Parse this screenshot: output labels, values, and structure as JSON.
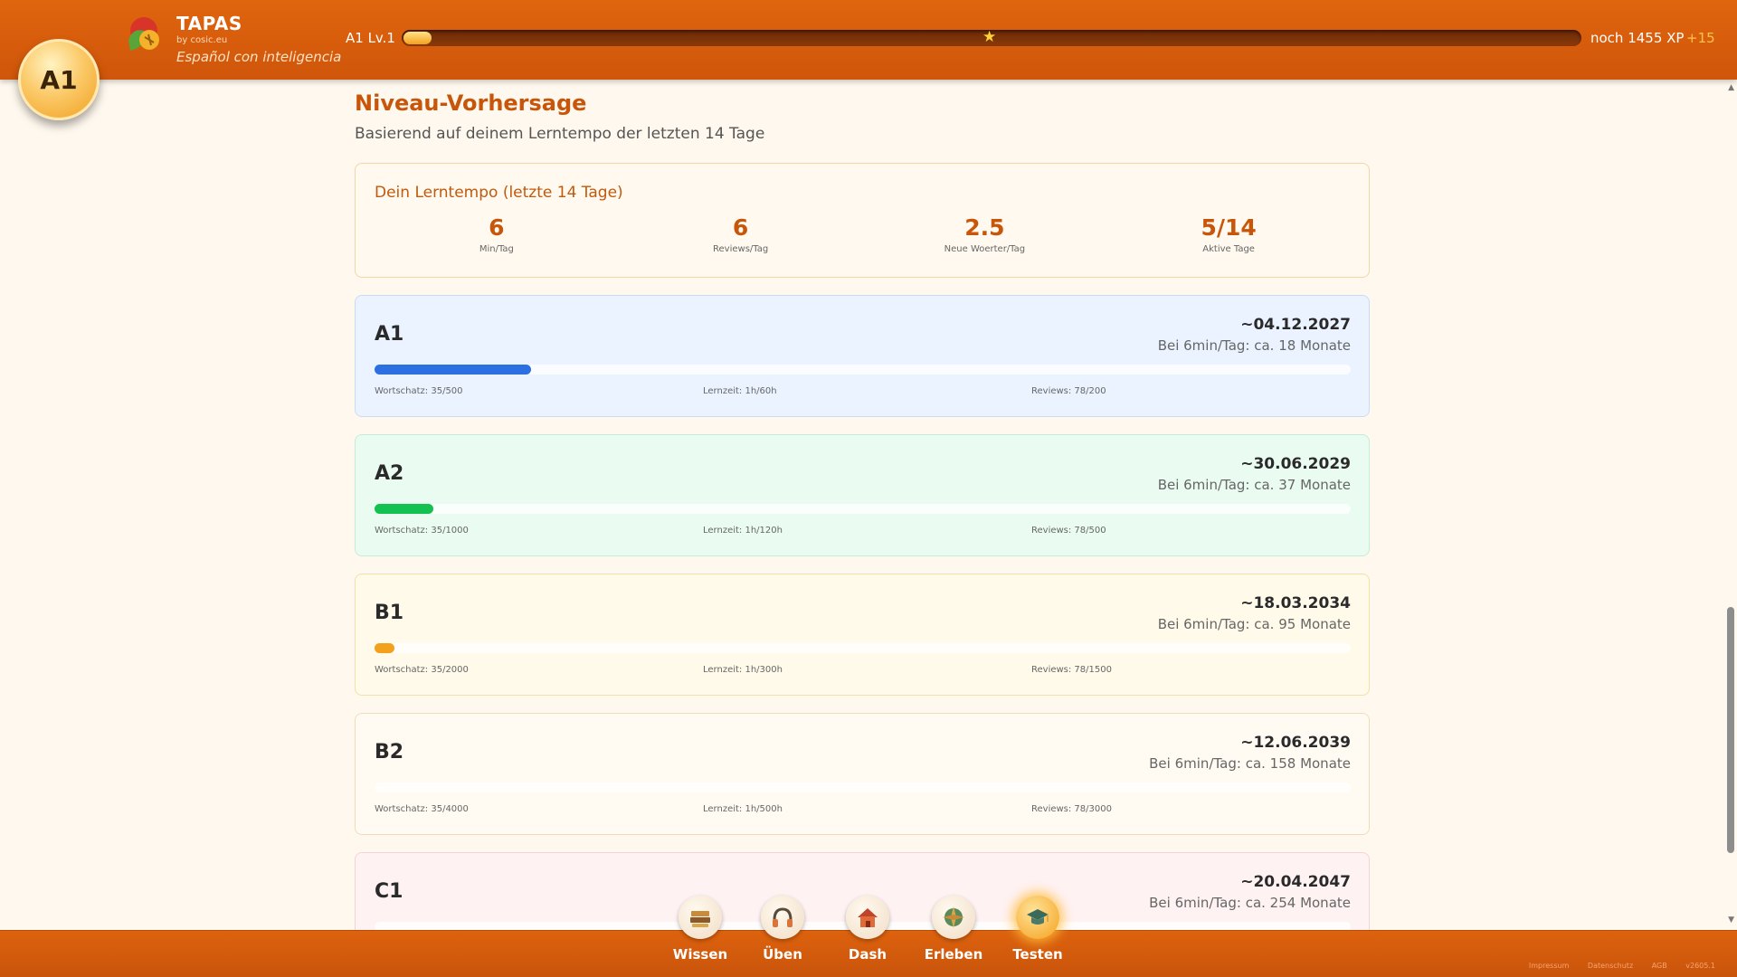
{
  "header": {
    "level_badge": "A1",
    "brand_name": "TAPAS",
    "brand_by": "by cosic.eu",
    "brand_tagline": "Español con inteligencia",
    "xp_level_label": "A1 Lv.1",
    "xp_progress": 0.024,
    "milestone_position": 0.5,
    "xp_remaining": "noch 1455 XP",
    "xp_gain": "+15"
  },
  "main": {
    "title": "Niveau-Vorhersage",
    "subtitle": "Basierend auf deinem Lerntempo der letzten 14 Tage",
    "tempo": {
      "title": "Dein Lerntempo (letzte 14 Tage)",
      "stats": [
        {
          "value": "6",
          "label": "Min/Tag"
        },
        {
          "value": "6",
          "label": "Reviews/Tag"
        },
        {
          "value": "2.5",
          "label": "Neue Woerter/Tag"
        },
        {
          "value": "5/14",
          "label": "Aktive Tage"
        }
      ]
    },
    "levels": [
      {
        "name": "A1",
        "date": "~04.12.2027",
        "estimate": "Bei 6min/Tag: ca. 18 Monate",
        "progress": 0.16,
        "bar_color": "#2b6fe0",
        "vocab": "Wortschatz: 35/500",
        "time": "Lernzeit: 1h/60h",
        "reviews": "Reviews: 78/200"
      },
      {
        "name": "A2",
        "date": "~30.06.2029",
        "estimate": "Bei 6min/Tag: ca. 37 Monate",
        "progress": 0.06,
        "bar_color": "#13c150",
        "vocab": "Wortschatz: 35/1000",
        "time": "Lernzeit: 1h/120h",
        "reviews": "Reviews: 78/500"
      },
      {
        "name": "B1",
        "date": "~18.03.2034",
        "estimate": "Bei 6min/Tag: ca. 95 Monate",
        "progress": 0.02,
        "bar_color": "#f3a01c",
        "vocab": "Wortschatz: 35/2000",
        "time": "Lernzeit: 1h/300h",
        "reviews": "Reviews: 78/1500"
      },
      {
        "name": "B2",
        "date": "~12.06.2039",
        "estimate": "Bei 6min/Tag: ca. 158 Monate",
        "progress": 0.0,
        "bar_color": "#e06a2a",
        "vocab": "Wortschatz: 35/4000",
        "time": "Lernzeit: 1h/500h",
        "reviews": "Reviews: 78/3000"
      },
      {
        "name": "C1",
        "date": "~20.04.2047",
        "estimate": "Bei 6min/Tag: ca. 254 Monate",
        "progress": 0.0,
        "bar_color": "#e04b5a",
        "vocab": "",
        "time": "",
        "reviews": ""
      }
    ]
  },
  "nav": {
    "items": [
      {
        "label": "Wissen",
        "icon": "books-icon"
      },
      {
        "label": "Üben",
        "icon": "headphones-icon"
      },
      {
        "label": "Dash",
        "icon": "house-icon"
      },
      {
        "label": "Erleben",
        "icon": "compass-icon"
      },
      {
        "label": "Testen",
        "icon": "graduation-cap-icon",
        "active": true
      }
    ]
  },
  "footer": {
    "links": [
      "Impressum",
      "Datenschutz",
      "AGB",
      "v2605.1"
    ]
  }
}
